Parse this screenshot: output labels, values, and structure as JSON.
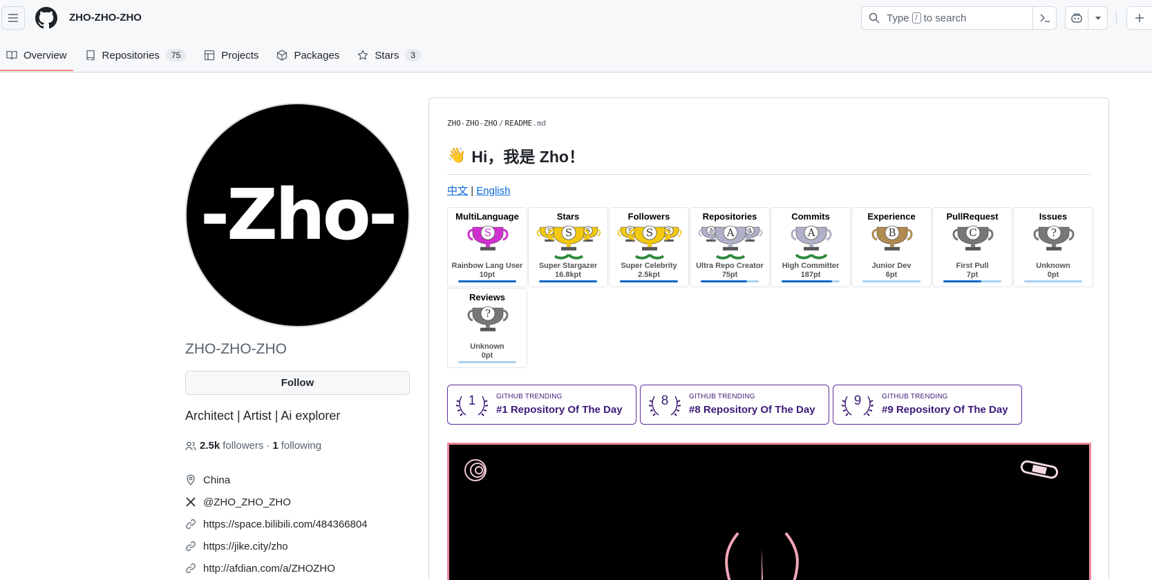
{
  "header": {
    "context_title": "ZHO-ZHO-ZHO",
    "search": {
      "prefix": "Type",
      "key": "/",
      "suffix": "to search"
    }
  },
  "tabs": [
    {
      "label": "Overview",
      "count": null,
      "active": true,
      "icon": "book-icon"
    },
    {
      "label": "Repositories",
      "count": "75",
      "active": false,
      "icon": "repo-icon"
    },
    {
      "label": "Projects",
      "count": null,
      "active": false,
      "icon": "table-icon"
    },
    {
      "label": "Packages",
      "count": null,
      "active": false,
      "icon": "package-icon"
    },
    {
      "label": "Stars",
      "count": "3",
      "active": false,
      "icon": "star-icon"
    }
  ],
  "profile": {
    "avatar_text": "-Zho-",
    "name": "ZHO-ZHO-ZHO",
    "follow_label": "Follow",
    "bio": "Architect | Artist | Ai explorer",
    "followers_count": "2.5k",
    "followers_label": "followers",
    "dot": "·",
    "following_count": "1",
    "following_label": "following",
    "location": "China",
    "twitter": "@ZHO_ZHO_ZHO",
    "links": [
      "https://space.bilibili.com/484366804",
      "https://jike.city/zho",
      "http://afdian.com/a/ZHOZHO"
    ]
  },
  "readme": {
    "owner": "ZHO-ZHO-ZHO",
    "separator": "/",
    "file_base": "README",
    "file_ext": ".md",
    "heading": "Hi，我是 Zho！",
    "wave": "👋",
    "lang_cn": "中文",
    "lang_pipe": "|",
    "lang_en": "English"
  },
  "trophies": [
    {
      "title": "MultiLanguage",
      "rank": "S",
      "name": "Rainbow Lang User",
      "points": "10pt",
      "progress": 1.0,
      "color": "#d02fd0"
    },
    {
      "title": "Stars",
      "rank": "S",
      "name": "Super Stargazer",
      "points": "16.8kpt",
      "progress": 1.0,
      "color": "#f2c811"
    },
    {
      "title": "Followers",
      "rank": "S",
      "name": "Super Celebrity",
      "points": "2.5kpt",
      "progress": 1.0,
      "color": "#f2c811"
    },
    {
      "title": "Repositories",
      "rank": "A",
      "name": "Ultra Repo Creator",
      "points": "75pt",
      "progress": 0.8,
      "color": "#b0b0c8"
    },
    {
      "title": "Commits",
      "rank": "A",
      "name": "High Committer",
      "points": "187pt",
      "progress": 0.87,
      "color": "#b0b0c8"
    },
    {
      "title": "Experience",
      "rank": "B",
      "name": "Junior Dev",
      "points": "6pt",
      "progress": 0.0,
      "color": "#b08a50"
    },
    {
      "title": "PullRequest",
      "rank": "C",
      "name": "First Pull",
      "points": "7pt",
      "progress": 0.65,
      "color": "#777777"
    },
    {
      "title": "Issues",
      "rank": "?",
      "name": "Unknown",
      "points": "0pt",
      "progress": 0.0,
      "color": "#777777"
    },
    {
      "title": "Reviews",
      "rank": "?",
      "name": "Unknown",
      "points": "0pt",
      "progress": 0.0,
      "color": "#777777"
    }
  ],
  "trending_badges": [
    {
      "rank": "1",
      "label": "GITHUB TRENDING",
      "title": "#1 Repository Of The Day"
    },
    {
      "rank": "8",
      "label": "GITHUB TRENDING",
      "title": "#8 Repository Of The Day"
    },
    {
      "rank": "9",
      "label": "GITHUB TRENDING",
      "title": "#9 Repository Of The Day"
    }
  ],
  "colors": {
    "accent_tab": "#fd8c73",
    "link": "#0969da",
    "badge": "#3b1a78",
    "banner_border": "#f08aa0"
  }
}
